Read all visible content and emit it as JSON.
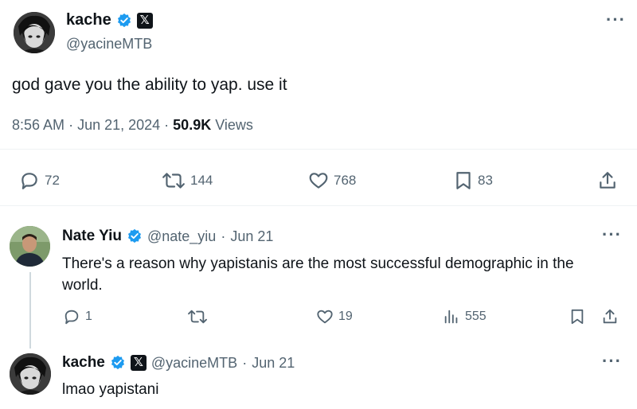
{
  "main_tweet": {
    "author_name": "kache",
    "author_handle": "@yacineMTB",
    "text": "god gave you the ability to yap. use it",
    "time": "8:56 AM",
    "date": "Jun 21, 2024",
    "views_count": "50.9K",
    "views_label": "Views",
    "replies": "72",
    "retweets": "144",
    "likes": "768",
    "bookmarks": "83",
    "more": "···"
  },
  "reply": {
    "author_name": "Nate Yiu",
    "author_handle": "@nate_yiu",
    "date": "Jun 21",
    "text": "There's a reason why yapistanis are the most successful demographic in the world.",
    "replies": "1",
    "likes": "19",
    "views": "555",
    "more": "···"
  },
  "self_reply": {
    "author_name": "kache",
    "author_handle": "@yacineMTB",
    "date": "Jun 21",
    "text": "lmao yapistani",
    "more": "···"
  },
  "colors": {
    "verified": "#1d9bf0",
    "text": "#0f1419",
    "muted": "#536471",
    "divider": "#eff3f4"
  }
}
